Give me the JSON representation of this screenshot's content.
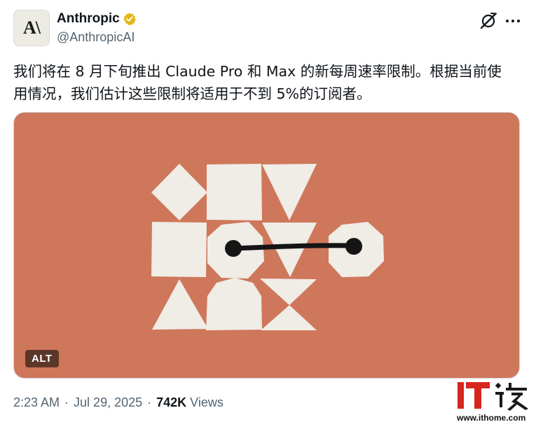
{
  "author": {
    "avatar_text": "A\\",
    "display_name": "Anthropic",
    "handle": "@AnthropicAI",
    "verified_color": "#e2b719"
  },
  "icons": {
    "verified": "verified-badge-icon",
    "grok": "grok-icon",
    "more": "more-options-icon"
  },
  "tweet": {
    "text_lines": [
      "我们将在 8 月下旬推出 Claude Pro 和 Max 的新每周速率限制。根据当前使",
      "用情况，我们估计这些限制将适用于不到 5%的订阅者。"
    ]
  },
  "media": {
    "background_color": "#cf775b",
    "shape_color": "#f0ece6",
    "line_color": "#151515",
    "alt_label": "ALT"
  },
  "meta": {
    "time": "2:23 AM",
    "separator": "·",
    "date": "Jul 29, 2025",
    "views_count": "742K",
    "views_label": "Views"
  },
  "watermark": {
    "logo_text": "IT之家",
    "url": "www.ithome.com",
    "brand_color": "#d7261e"
  }
}
